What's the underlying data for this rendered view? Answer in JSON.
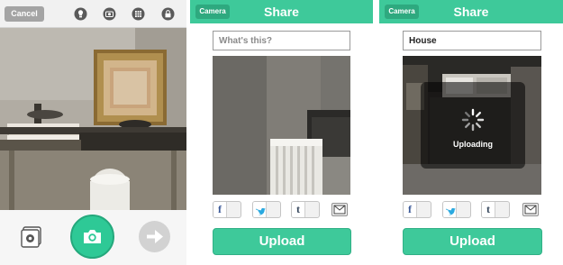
{
  "camera_screen": {
    "cancel_label": "Cancel",
    "top_icons": [
      "lightbulb-icon",
      "flip-camera-icon",
      "grid-icon",
      "lock-icon"
    ],
    "bottom_icons": [
      "gallery-icon",
      "camera-icon",
      "arrow-right-icon"
    ]
  },
  "share_screen_empty": {
    "back_label": "Camera",
    "title": "Share",
    "caption_placeholder": "What's this?",
    "caption_value": "",
    "social_icons": [
      "facebook-icon",
      "twitter-icon",
      "tumblr-icon",
      "mail-icon"
    ],
    "social_glyphs": {
      "facebook": "f",
      "twitter": "",
      "tumblr": "t"
    },
    "upload_label": "Upload"
  },
  "share_screen_uploading": {
    "back_label": "Camera",
    "title": "Share",
    "caption_value": "House",
    "status_label": "Uploading",
    "social_glyphs": {
      "facebook": "f",
      "twitter": "",
      "tumblr": "t"
    },
    "upload_label": "Upload"
  },
  "colors": {
    "accent": "#3ec99a",
    "accent_dark": "#2ea97f",
    "shutter": "#2ec996",
    "facebook": "#3b5998",
    "twitter": "#2aa9e0",
    "tumblr": "#35465c"
  }
}
